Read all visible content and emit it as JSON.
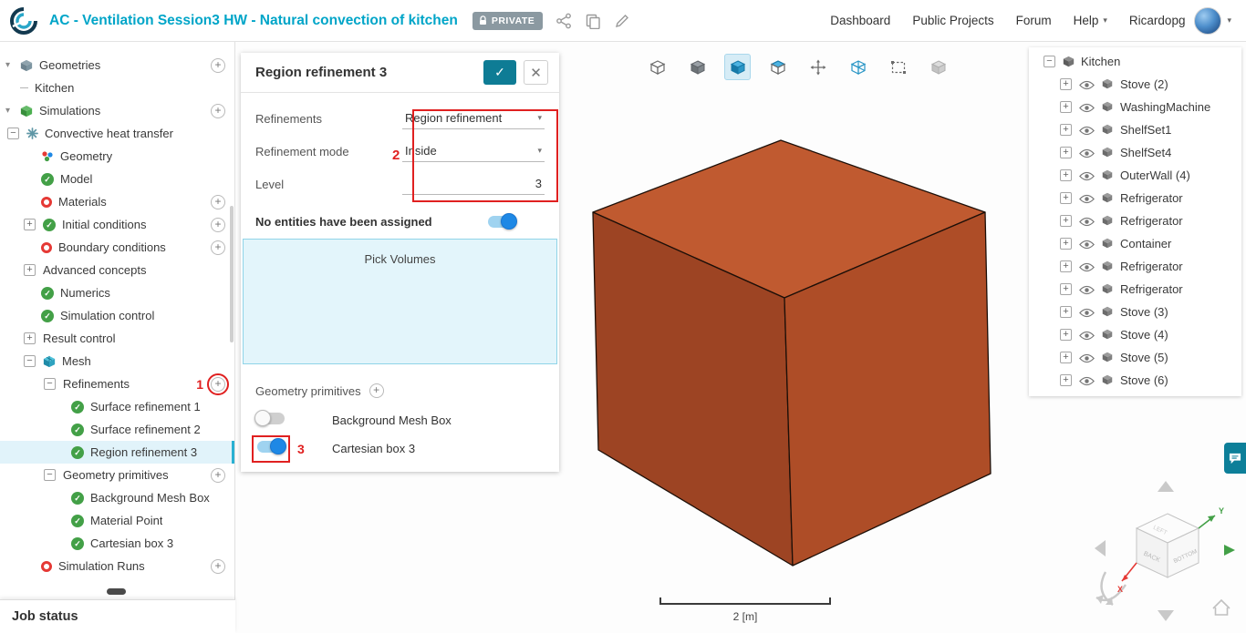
{
  "header": {
    "title": "AC - Ventilation Session3 HW - Natural convection of kitchen",
    "private_label": "PRIVATE",
    "nav": [
      {
        "label": "Dashboard"
      },
      {
        "label": "Public Projects"
      },
      {
        "label": "Forum"
      },
      {
        "label": "Help",
        "caret": true
      }
    ],
    "user": "Ricardopg"
  },
  "left_tree": [
    {
      "label": "Geometries",
      "indent": 6,
      "caret": "arrow",
      "icon": "geometries",
      "plus": true
    },
    {
      "label": "Kitchen",
      "indent": 22,
      "icon": "dash",
      "sep": true
    },
    {
      "label": "Simulations",
      "indent": 6,
      "caret": "arrow",
      "icon": "simulations",
      "plus": true
    },
    {
      "label": "Convective heat transfer",
      "indent": 8,
      "caret": "minus",
      "icon": "heat"
    },
    {
      "label": "Geometry",
      "indent": 45,
      "icon": "geometry"
    },
    {
      "label": "Model",
      "indent": 45,
      "icon": "check"
    },
    {
      "label": "Materials",
      "indent": 45,
      "icon": "red",
      "plus": true
    },
    {
      "label": "Initial conditions",
      "indent": 26,
      "caret": "plus",
      "icon": "check",
      "plus": true
    },
    {
      "label": "Boundary conditions",
      "indent": 45,
      "icon": "red",
      "plus": true
    },
    {
      "label": "Advanced concepts",
      "indent": 26,
      "caret": "plus",
      "icon": "none"
    },
    {
      "label": "Numerics",
      "indent": 45,
      "icon": "check"
    },
    {
      "label": "Simulation control",
      "indent": 45,
      "icon": "check"
    },
    {
      "label": "Result control",
      "indent": 26,
      "caret": "plus",
      "icon": "none"
    },
    {
      "label": "Mesh",
      "indent": 26,
      "caret": "minus",
      "icon": "mesh"
    },
    {
      "label": "Refinements",
      "indent": 48,
      "caret": "minus",
      "icon": "none",
      "plus": true,
      "plus_boxed": true,
      "annot": "1"
    },
    {
      "label": "Surface refinement 1",
      "indent": 78,
      "icon": "check"
    },
    {
      "label": "Surface refinement 2",
      "indent": 78,
      "icon": "check"
    },
    {
      "label": "Region refinement 3",
      "indent": 78,
      "icon": "check",
      "selected": true
    },
    {
      "label": "Geometry primitives",
      "indent": 48,
      "caret": "minus",
      "icon": "none",
      "plus": true
    },
    {
      "label": "Background Mesh Box",
      "indent": 78,
      "icon": "check"
    },
    {
      "label": "Material Point",
      "indent": 78,
      "icon": "check"
    },
    {
      "label": "Cartesian box 3",
      "indent": 78,
      "icon": "check"
    },
    {
      "label": "Simulation Runs",
      "indent": 45,
      "icon": "red",
      "plus": true
    }
  ],
  "job_status": "Job status",
  "panel": {
    "title": "Region refinement 3",
    "fields": [
      {
        "label": "Refinements",
        "value": "Region refinement",
        "kind": "select"
      },
      {
        "label": "Refinement mode",
        "value": "Inside",
        "kind": "select"
      },
      {
        "label": "Level",
        "value": "3",
        "kind": "number"
      }
    ],
    "assigned": "No entities have been assigned",
    "pick": "Pick Volumes",
    "primitives_label": "Geometry primitives",
    "toggles": [
      {
        "label": "Background Mesh Box",
        "on": false
      },
      {
        "label": "Cartesian box 3",
        "on": true,
        "boxed": true,
        "annot": "3"
      }
    ]
  },
  "annotations": {
    "step1": "1",
    "step2": "2",
    "step3": "3"
  },
  "viewport": {
    "toolbar": [
      {
        "name": "view-cube-standard",
        "kind": "cube-outline"
      },
      {
        "name": "render-solid",
        "kind": "cube-solid"
      },
      {
        "name": "render-mesh",
        "kind": "cube-blue",
        "active": true
      },
      {
        "name": "render-surfaces",
        "kind": "cube-faces"
      },
      {
        "name": "fit-view",
        "kind": "fit"
      },
      {
        "name": "section-view",
        "kind": "cube-wire"
      },
      {
        "name": "box-select",
        "kind": "select"
      },
      {
        "name": "hide-geometry",
        "kind": "cube-gray"
      }
    ],
    "scale_label": "2 [m]"
  },
  "right_tree": {
    "root": "Kitchen",
    "children": [
      {
        "label": "Stove (2)"
      },
      {
        "label": "WashingMachine"
      },
      {
        "label": "ShelfSet1"
      },
      {
        "label": "ShelfSet4"
      },
      {
        "label": "OuterWall (4)"
      },
      {
        "label": "Refrigerator"
      },
      {
        "label": "Refrigerator"
      },
      {
        "label": "Container"
      },
      {
        "label": "Refrigerator"
      },
      {
        "label": "Refrigerator"
      },
      {
        "label": "Stove (3)"
      },
      {
        "label": "Stove (4)"
      },
      {
        "label": "Stove (5)"
      },
      {
        "label": "Stove (6)"
      }
    ]
  },
  "nav_cube": {
    "face_left": "BACK",
    "face_right": "BOTTOM",
    "face_top": "LEFT",
    "axis_x": "X",
    "axis_y": "Y"
  },
  "colors": {
    "accent": "#00a5c8",
    "confirm_button": "#0e7c95",
    "annotation": "#e02020",
    "toggle_on": "#1e88e5",
    "cube_top": "#c05a30",
    "cube_left": "#9d4423",
    "cube_right": "#ae4d27"
  }
}
